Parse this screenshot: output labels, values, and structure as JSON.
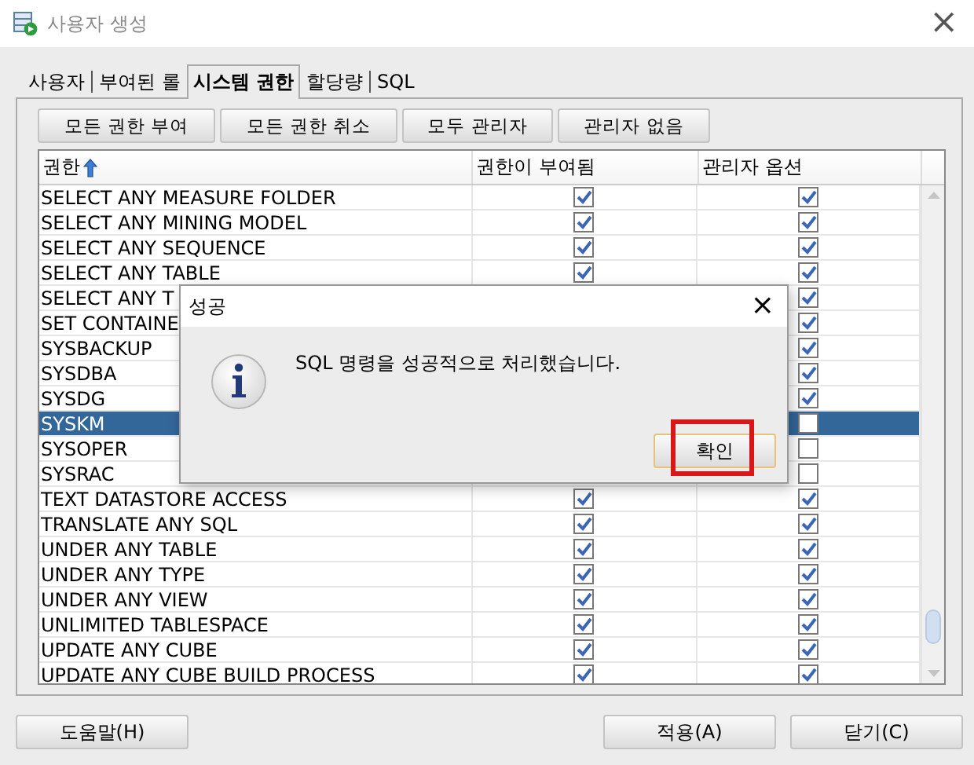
{
  "window": {
    "title": "사용자 생성",
    "close": "×"
  },
  "tabs": [
    {
      "label": "사용자",
      "selected": false
    },
    {
      "label": "부여된 롤",
      "selected": false
    },
    {
      "label": "시스템 권한",
      "selected": true
    },
    {
      "label": "할당량",
      "selected": false
    },
    {
      "label": "SQL",
      "selected": false
    }
  ],
  "toolbar": [
    "모든 권한 부여",
    "모든 권한 취소",
    "모두 관리자",
    "관리자 없음"
  ],
  "table": {
    "columns": [
      "권한",
      "권한이 부여됨",
      "관리자 옵션"
    ],
    "rows": [
      {
        "name": "SELECT ANY MEASURE FOLDER",
        "granted": true,
        "admin": true,
        "selected": false
      },
      {
        "name": "SELECT ANY MINING MODEL",
        "granted": true,
        "admin": true,
        "selected": false
      },
      {
        "name": "SELECT ANY SEQUENCE",
        "granted": true,
        "admin": true,
        "selected": false
      },
      {
        "name": "SELECT ANY TABLE",
        "granted": true,
        "admin": true,
        "selected": false
      },
      {
        "name": "SELECT ANY T",
        "admin": true,
        "selected": false
      },
      {
        "name": "SET CONTAINE",
        "admin": true,
        "selected": false
      },
      {
        "name": "SYSBACKUP",
        "admin": true,
        "selected": false
      },
      {
        "name": "SYSDBA",
        "admin": true,
        "selected": false
      },
      {
        "name": "SYSDG",
        "admin": true,
        "selected": false
      },
      {
        "name": "SYSKM",
        "admin": false,
        "selected": true
      },
      {
        "name": "SYSOPER",
        "admin": false,
        "selected": false
      },
      {
        "name": "SYSRAC",
        "admin": false,
        "selected": false
      },
      {
        "name": "TEXT DATASTORE ACCESS",
        "granted": true,
        "admin": true,
        "selected": false
      },
      {
        "name": "TRANSLATE ANY SQL",
        "granted": true,
        "admin": true,
        "selected": false
      },
      {
        "name": "UNDER ANY TABLE",
        "granted": true,
        "admin": true,
        "selected": false
      },
      {
        "name": "UNDER ANY TYPE",
        "granted": true,
        "admin": true,
        "selected": false
      },
      {
        "name": "UNDER ANY VIEW",
        "granted": true,
        "admin": true,
        "selected": false
      },
      {
        "name": "UNLIMITED TABLESPACE",
        "granted": true,
        "admin": true,
        "selected": false
      },
      {
        "name": "UPDATE ANY CUBE",
        "granted": true,
        "admin": true,
        "selected": false
      },
      {
        "name": "UPDATE ANY CUBE BUILD PROCESS",
        "granted": true,
        "admin": true,
        "selected": false
      }
    ]
  },
  "dialog": {
    "title": "성공",
    "close": "×",
    "message": "SQL 명령을 성공적으로 처리했습니다.",
    "button": "확인"
  },
  "footer": {
    "help": "도움말(H)",
    "apply": "적용(A)",
    "close": "닫기(C)"
  }
}
